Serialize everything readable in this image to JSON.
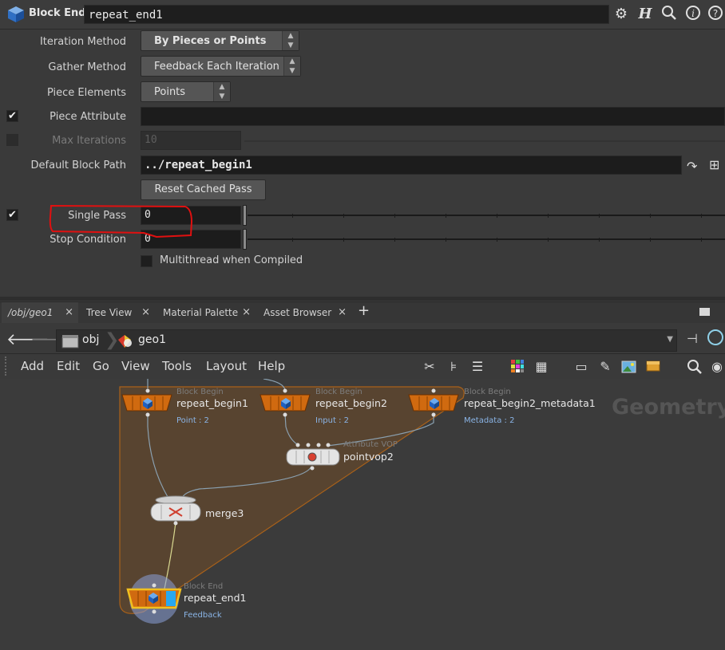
{
  "header": {
    "node_type": "Block End",
    "node_name": "repeat_end1",
    "icons": [
      "gear-icon",
      "help-h-icon",
      "search-icon",
      "info-icon",
      "help-icon"
    ]
  },
  "params": {
    "iteration_method": {
      "label": "Iteration Method",
      "value": "By Pieces or Points"
    },
    "gather_method": {
      "label": "Gather Method",
      "value": "Feedback Each Iteration"
    },
    "piece_elements": {
      "label": "Piece Elements",
      "value": "Points"
    },
    "piece_attribute": {
      "label": "Piece Attribute",
      "value": "",
      "checked": true
    },
    "max_iterations": {
      "label": "Max Iterations",
      "value": "10",
      "checked": false
    },
    "default_block_path": {
      "label": "Default Block Path",
      "value": "../repeat_begin1"
    },
    "reset_cached_pass": {
      "label": "Reset Cached Pass"
    },
    "single_pass": {
      "label": "Single Pass",
      "value": "0",
      "checked": true
    },
    "stop_condition": {
      "label": "Stop Condition",
      "value": "0"
    },
    "multithread": {
      "label": "Multithread when Compiled",
      "checked": false
    }
  },
  "tabs": [
    {
      "label": "/obj/geo1",
      "active": true
    },
    {
      "label": "Tree View"
    },
    {
      "label": "Material Palette"
    },
    {
      "label": "Asset Browser"
    }
  ],
  "path": {
    "obj": "obj",
    "geo": "geo1"
  },
  "menu": [
    "Add",
    "Edit",
    "Go",
    "View",
    "Tools",
    "Layout",
    "Help"
  ],
  "network": {
    "context_label": "Geometry",
    "nodes": {
      "repeat_begin1": {
        "type": "Block Begin",
        "name": "repeat_begin1",
        "info": "Point : 2"
      },
      "repeat_begin2": {
        "type": "Block Begin",
        "name": "repeat_begin2",
        "info": "Input : 2"
      },
      "repeat_begin2_metadata1": {
        "type": "Block Begin",
        "name": "repeat_begin2_metadata1",
        "info": "Metadata : 2"
      },
      "pointvop2": {
        "type": "Attribute VOP",
        "name": "pointvop2"
      },
      "merge3": {
        "name": "merge3"
      },
      "repeat_end1": {
        "type": "Block End",
        "name": "repeat_end1",
        "info": "Feedback"
      }
    }
  },
  "colors": {
    "annotation": "#e01010",
    "block_node": "#c8620e",
    "selected": "#f0c020",
    "info_text": "#8ab4e6"
  }
}
